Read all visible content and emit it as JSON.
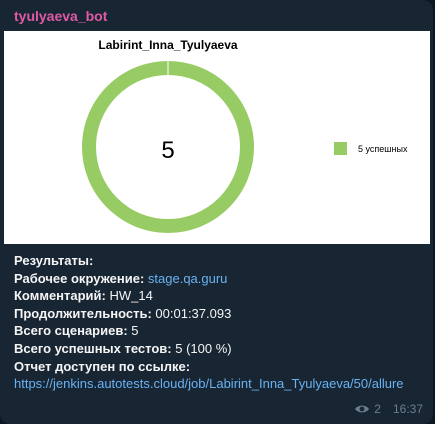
{
  "sender": {
    "name": "tyulyaeva_bot"
  },
  "chart_data": {
    "type": "pie",
    "title": "Labirint_Inna_Tyulyaeva",
    "center_label": "5",
    "slices": [
      {
        "label": "5 успешных",
        "value": 5,
        "color": "#97cc64"
      }
    ],
    "legend_position": "right"
  },
  "report": {
    "header": "Результаты:",
    "env_label": "Рабочее окружение:",
    "env_value": "stage.qa.guru",
    "comment_label": "Комментарий:",
    "comment_value": "HW_14",
    "duration_label": "Продолжительность:",
    "duration_value": "00:01:37.093",
    "scenarios_label": "Всего сценариев:",
    "scenarios_value": "5",
    "passed_label": "Всего успешных тестов:",
    "passed_value": "5 (100 %)",
    "link_label": "Отчет доступен по ссылке:",
    "link_url": "https://jenkins.autotests.cloud/job/Labirint_Inna_Tyulyaeva/50/allure"
  },
  "meta": {
    "views": "2",
    "time": "16:37"
  },
  "colors": {
    "accent_link": "#6ab2f2",
    "sender": "#e05aa5",
    "ring": "#97cc64"
  }
}
